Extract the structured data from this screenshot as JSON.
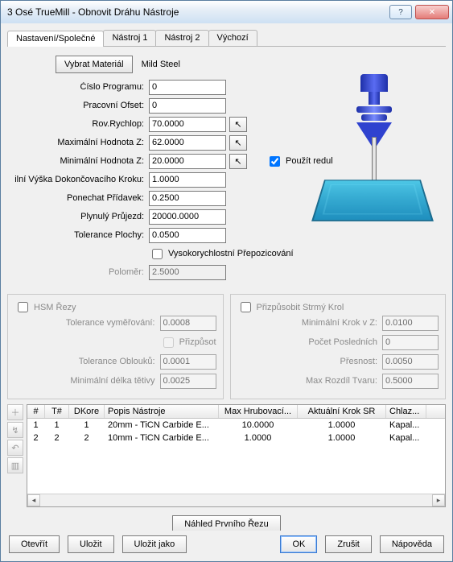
{
  "window": {
    "title": "3 Osé TrueMill - Obnovit Dráhu Nástroje"
  },
  "tabs": {
    "items": [
      "Nastavení/Společné",
      "Nástroj 1",
      "Nástroj 2",
      "Výchozí"
    ],
    "active": 0
  },
  "material": {
    "button": "Vybrat Materiál",
    "name": "Mild Steel"
  },
  "fields": {
    "program_no": {
      "label": "Číslo Programu:",
      "value": "0"
    },
    "work_offset": {
      "label": "Pracovní Ofset:",
      "value": "0"
    },
    "rapid_plane": {
      "label": "Rov.Rychlop:",
      "value": "70.0000"
    },
    "max_z": {
      "label": "Maximální Hodnota Z:",
      "value": "62.0000"
    },
    "min_z": {
      "label": "Minimální Hodnota Z:",
      "value": "20.0000"
    },
    "finish_step": {
      "label": "ilní Výška Dokončovacího Kroku:",
      "value": "1.0000"
    },
    "leave_allow": {
      "label": "Ponechat Přídavek:",
      "value": "0.2500"
    },
    "smooth_pass": {
      "label": "Plynulý Průjezd:",
      "value": "20000.0000"
    },
    "surf_tol": {
      "label": "Tolerance Plochy:",
      "value": "0.0500"
    },
    "hsm_repos": {
      "label": "Vysokorychlostní Přepozicování"
    },
    "radius": {
      "label": "Poloměr:",
      "value": "2.5000"
    },
    "use_redul": {
      "label": "Použít redul",
      "checked": true
    }
  },
  "group_hsm": {
    "title": "HSM Řezy",
    "tol_meas": {
      "label": "Tolerance vyměřování:",
      "value": "0.0008"
    },
    "adapt": {
      "label": "Přizpůsot"
    },
    "arc_tol": {
      "label": "Tolerance Oblouků:",
      "value": "0.0001"
    },
    "min_chord": {
      "label": "Minimální délka tětivy",
      "value": "0.0025"
    }
  },
  "group_steep": {
    "title": "Přizpůsobit Strmý Krol",
    "min_step_z": {
      "label": "Minimální Krok v Z:",
      "value": "0.0100"
    },
    "last_count": {
      "label": "Počet Posledních",
      "value": "0"
    },
    "accuracy": {
      "label": "Přesnost:",
      "value": "0.0050"
    },
    "max_shape": {
      "label": "Max Rozdíl Tvaru:",
      "value": "0.5000"
    }
  },
  "grid": {
    "headers": [
      "#",
      "T#",
      "DKore",
      "Popis Nástroje",
      "Max Hrubovací...",
      "Aktuální Krok SR",
      "Chlaz..."
    ],
    "rows": [
      {
        "n": "1",
        "t": "1",
        "d": "1",
        "desc": "20mm - TiCN Carbide E...",
        "maxr": "10.0000",
        "step": "1.0000",
        "cool": "Kapal..."
      },
      {
        "n": "2",
        "t": "2",
        "d": "2",
        "desc": "10mm - TiCN Carbide E...",
        "maxr": "1.0000",
        "step": "1.0000",
        "cool": "Kapal..."
      }
    ]
  },
  "preview_btn": "Náhled Prvního Řezu",
  "footer": {
    "open": "Otevřít",
    "save": "Uložit",
    "saveas": "Uložit jako",
    "ok": "OK",
    "cancel": "Zrušit",
    "help": "Nápověda"
  }
}
